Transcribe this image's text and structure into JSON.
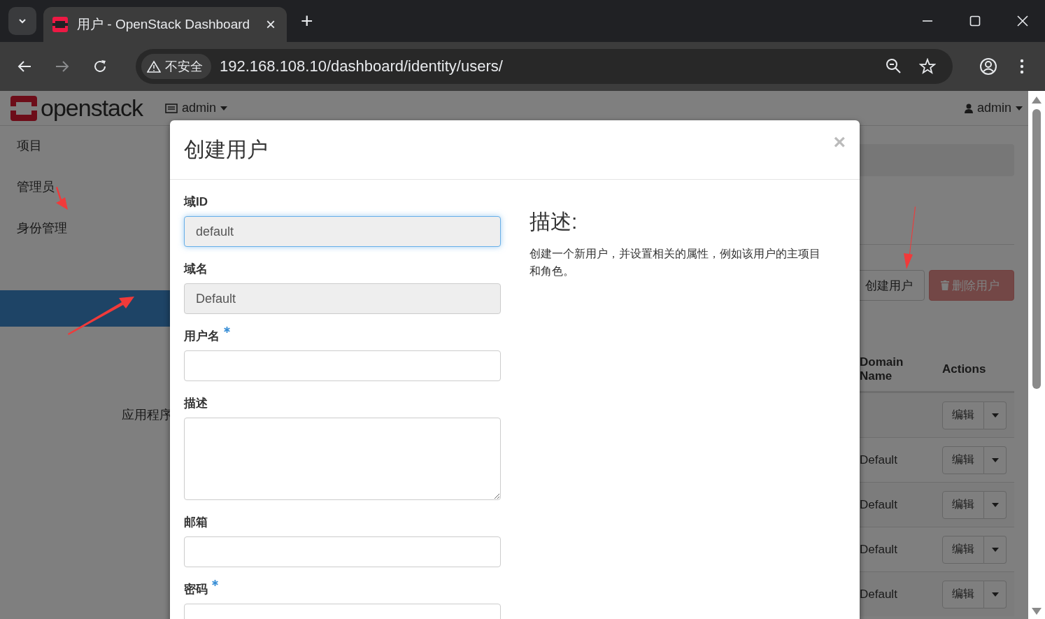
{
  "browser": {
    "tab": {
      "title": "用户 - OpenStack Dashboard",
      "close": "×"
    },
    "new_tab": "+",
    "security": "不安全",
    "url": "192.168.108.10/dashboard/identity/users/"
  },
  "header": {
    "logo": "openstack",
    "project_menu": "admin",
    "user_menu": "admin"
  },
  "sidebar": {
    "items": [
      {
        "label": "项目"
      },
      {
        "label": "管理员"
      },
      {
        "label": "身份管理"
      }
    ],
    "lower_item": "应用程序"
  },
  "content": {
    "buttons": [
      {
        "label": "创建用户",
        "kind": "default",
        "disabled": false
      },
      {
        "label": "删除用户",
        "kind": "danger",
        "disabled": true
      }
    ],
    "table": {
      "columns": [
        "Domain Name",
        "Actions"
      ],
      "rows": [
        {
          "action": "编辑"
        },
        {
          "domain_name": "Default",
          "action": "编辑"
        },
        {
          "domain_name": "Default",
          "action": "编辑"
        },
        {
          "domain_name": "Default",
          "action": "编辑"
        },
        {
          "domain_name": "Default",
          "action": "编辑"
        }
      ]
    }
  },
  "modal": {
    "title": "创建用户",
    "close": "×",
    "fields": [
      {
        "label": "域ID",
        "kind": "input",
        "value": "default",
        "readonly": true,
        "focused": true,
        "required": false
      },
      {
        "label": "域名",
        "kind": "input",
        "value": "Default",
        "readonly": true,
        "focused": false,
        "required": false
      },
      {
        "label": "用户名",
        "kind": "input",
        "readonly": false,
        "focused": false,
        "required": true
      },
      {
        "label": "描述",
        "kind": "textarea",
        "readonly": false,
        "focused": false,
        "required": false
      },
      {
        "label": "邮箱",
        "kind": "input",
        "readonly": false,
        "focused": false,
        "required": false
      },
      {
        "label": "密码",
        "kind": "input",
        "readonly": false,
        "focused": false,
        "required": true
      }
    ],
    "help_title": "描述:",
    "help_text": "创建一个新用户，并设置相关的属性，例如该用户的主项目和角色。"
  }
}
